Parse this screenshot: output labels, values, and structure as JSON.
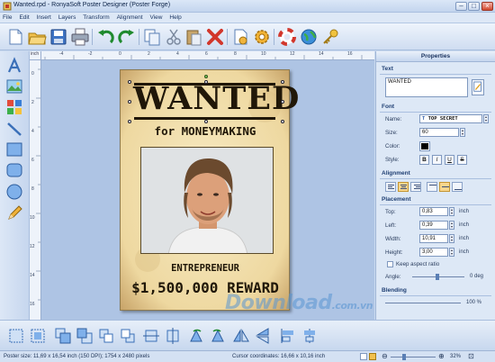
{
  "window": {
    "title": "Wanted.rpd - RonyaSoft Poster Designer (Poster Forge)"
  },
  "menu": [
    "File",
    "Edit",
    "Insert",
    "Layers",
    "Transform",
    "Alignment",
    "View",
    "Help"
  ],
  "ruler": {
    "unit_label": "inch",
    "top_ticks": [
      "-4",
      "-2",
      "0",
      "2",
      "4",
      "6",
      "8",
      "10",
      "12",
      "14",
      "16"
    ],
    "left_ticks": [
      "0",
      "2",
      "4",
      "6",
      "8",
      "10",
      "12",
      "14",
      "16"
    ]
  },
  "poster": {
    "headline": "WANTED",
    "subline": "for MONEYMAKING",
    "occupation": "ENTREPRENEUR",
    "reward": "$1,500,000 REWARD"
  },
  "properties": {
    "header": "Properties",
    "text_section": "Text",
    "text_value": "WANTED",
    "font_section": "Font",
    "name_label": "Name:",
    "font_name": "TOP SECRET",
    "size_label": "Size:",
    "font_size": "60",
    "color_label": "Color:",
    "font_color": "#000000",
    "style_label": "Style:",
    "style_buttons": [
      "B",
      "I",
      "U",
      "S"
    ],
    "alignment_section": "Alignment",
    "placement_section": "Placement",
    "top_label": "Top:",
    "top_value": "0,83",
    "left_label": "Left:",
    "left_value": "0,39",
    "width_label": "Width:",
    "width_value": "10,91",
    "height_label": "Height:",
    "height_value": "3,00",
    "unit": "inch",
    "keep_aspect_label": "Keep aspect ratio",
    "angle_label": "Angle:",
    "angle_value": "0 deg",
    "blending_section": "Blending",
    "blending_value": "100 %"
  },
  "status": {
    "poster_size": "Poster size: 11,69 x 16,54 inch (150 DPI); 1754 x 2480 pixels",
    "cursor": "Cursor coordinates: 16,66 x 10,16 inch",
    "zoom": "32%"
  },
  "watermark": {
    "main": "Download",
    "suffix": ".com.vn"
  },
  "colors": {
    "accent": "#3a6fb8",
    "poster_paper": "#f3e2b0",
    "ink": "#201708"
  }
}
